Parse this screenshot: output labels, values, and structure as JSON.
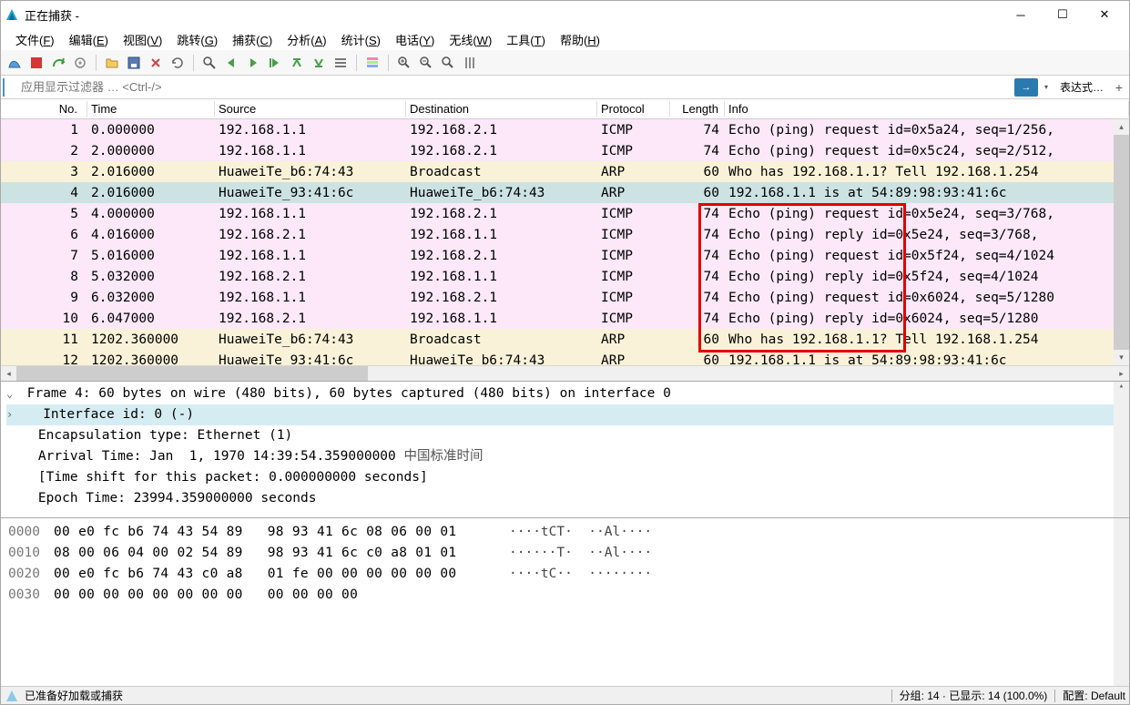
{
  "window": {
    "title": "正在捕获 -"
  },
  "menu": [
    "文件(F)",
    "编辑(E)",
    "视图(V)",
    "跳转(G)",
    "捕获(C)",
    "分析(A)",
    "统计(S)",
    "电话(Y)",
    "无线(W)",
    "工具(T)",
    "帮助(H)"
  ],
  "filter": {
    "placeholder": "应用显示过滤器 … <Ctrl-/>",
    "expr_label": "表达式…"
  },
  "columns": [
    "No.",
    "Time",
    "Source",
    "Destination",
    "Protocol",
    "Length",
    "Info"
  ],
  "packets": [
    {
      "cls": "pink",
      "no": "1",
      "time": "0.000000",
      "src": "192.168.1.1",
      "dst": "192.168.2.1",
      "proto": "ICMP",
      "len": "74",
      "info": "Echo (ping) request  id=0x5a24, seq=1/256,"
    },
    {
      "cls": "pink",
      "no": "2",
      "time": "2.000000",
      "src": "192.168.1.1",
      "dst": "192.168.2.1",
      "proto": "ICMP",
      "len": "74",
      "info": "Echo (ping) request  id=0x5c24, seq=2/512,"
    },
    {
      "cls": "cream",
      "no": "3",
      "time": "2.016000",
      "src": "HuaweiTe_b6:74:43",
      "dst": "Broadcast",
      "proto": "ARP",
      "len": "60",
      "info": "Who has 192.168.1.1? Tell 192.168.1.254"
    },
    {
      "cls": "blue",
      "no": "4",
      "time": "2.016000",
      "src": "HuaweiTe_93:41:6c",
      "dst": "HuaweiTe_b6:74:43",
      "proto": "ARP",
      "len": "60",
      "info": "192.168.1.1 is at 54:89:98:93:41:6c"
    },
    {
      "cls": "pink",
      "no": "5",
      "time": "4.000000",
      "src": "192.168.1.1",
      "dst": "192.168.2.1",
      "proto": "ICMP",
      "len": "74",
      "info": "Echo (ping) request  id=0x5e24, seq=3/768,"
    },
    {
      "cls": "pink",
      "no": "6",
      "time": "4.016000",
      "src": "192.168.2.1",
      "dst": "192.168.1.1",
      "proto": "ICMP",
      "len": "74",
      "info": "Echo (ping) reply    id=0x5e24, seq=3/768,"
    },
    {
      "cls": "pink",
      "no": "7",
      "time": "5.016000",
      "src": "192.168.1.1",
      "dst": "192.168.2.1",
      "proto": "ICMP",
      "len": "74",
      "info": "Echo (ping) request  id=0x5f24, seq=4/1024"
    },
    {
      "cls": "pink",
      "no": "8",
      "time": "5.032000",
      "src": "192.168.2.1",
      "dst": "192.168.1.1",
      "proto": "ICMP",
      "len": "74",
      "info": "Echo (ping) reply    id=0x5f24, seq=4/1024"
    },
    {
      "cls": "pink",
      "no": "9",
      "time": "6.032000",
      "src": "192.168.1.1",
      "dst": "192.168.2.1",
      "proto": "ICMP",
      "len": "74",
      "info": "Echo (ping) request  id=0x6024, seq=5/1280"
    },
    {
      "cls": "pink",
      "no": "10",
      "time": "6.047000",
      "src": "192.168.2.1",
      "dst": "192.168.1.1",
      "proto": "ICMP",
      "len": "74",
      "info": "Echo (ping) reply    id=0x6024, seq=5/1280"
    },
    {
      "cls": "cream",
      "no": "11",
      "time": "1202.360000",
      "src": "HuaweiTe_b6:74:43",
      "dst": "Broadcast",
      "proto": "ARP",
      "len": "60",
      "info": "Who has 192.168.1.1? Tell 192.168.1.254"
    },
    {
      "cls": "cream",
      "no": "12",
      "time": "1202.360000",
      "src": "HuaweiTe_93:41:6c",
      "dst": "HuaweiTe_b6:74:43",
      "proto": "ARP",
      "len": "60",
      "info": "192.168.1.1 is at 54:89:98:93:41:6c"
    }
  ],
  "details": {
    "line1": "Frame 4: 60 bytes on wire (480 bits), 60 bytes captured (480 bits) on interface 0",
    "line2": "Interface id: 0 (-)",
    "line3": "Encapsulation type: Ethernet (1)",
    "line4a": "Arrival Time: Jan  1, 1970 14:39:54.359000000 ",
    "line4b": "中国标准时间",
    "line5": "[Time shift for this packet: 0.000000000 seconds]",
    "line6": "Epoch Time: 23994.359000000 seconds"
  },
  "hex": [
    {
      "off": "0000",
      "hx": "00 e0 fc b6 74 43 54 89   98 93 41 6c 08 06 00 01",
      "asc": "····tCT·  ··Al····"
    },
    {
      "off": "0010",
      "hx": "08 00 06 04 00 02 54 89   98 93 41 6c c0 a8 01 01",
      "asc": "······T·  ··Al····"
    },
    {
      "off": "0020",
      "hx": "00 e0 fc b6 74 43 c0 a8   01 fe 00 00 00 00 00 00",
      "asc": "····tC··  ········"
    },
    {
      "off": "0030",
      "hx": "00 00 00 00 00 00 00 00   00 00 00 00",
      "asc": ""
    }
  ],
  "status": {
    "left": "已准备好加载或捕获",
    "center": "分组: 14 · 已显示: 14 (100.0%)",
    "right": "配置: Default"
  }
}
